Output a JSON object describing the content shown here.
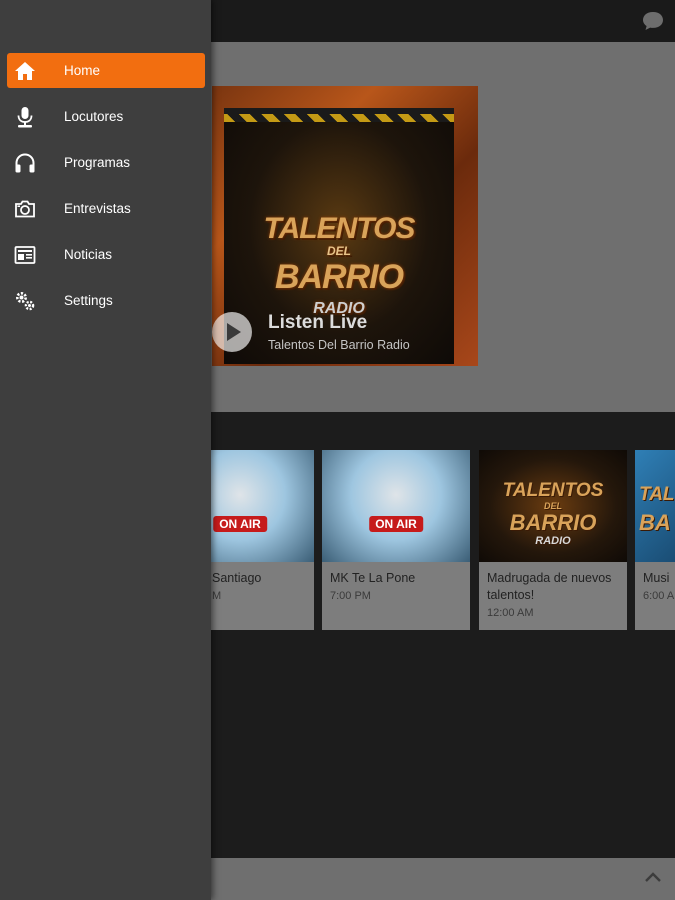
{
  "app": {
    "accent_color": "#f26e10",
    "drawer_color": "#3e3e3e"
  },
  "drawer": {
    "items": [
      {
        "label": "Home",
        "icon": "home-icon",
        "active": true
      },
      {
        "label": "Locutores",
        "icon": "microphone-icon",
        "active": false
      },
      {
        "label": "Programas",
        "icon": "headphones-icon",
        "active": false
      },
      {
        "label": "Entrevistas",
        "icon": "camera-icon",
        "active": false
      },
      {
        "label": "Noticias",
        "icon": "newspaper-icon",
        "active": false
      },
      {
        "label": "Settings",
        "icon": "gears-icon",
        "active": false
      }
    ]
  },
  "hero": {
    "logo_line_1": "TALENTOS",
    "logo_line_2": "DEL",
    "logo_line_3": "BARRIO",
    "logo_line_4": "RADIO",
    "title": "Listen Live",
    "subtitle": "Talentos Del Barrio Radio"
  },
  "programs": [
    {
      "title": "Santiago",
      "time": "M",
      "badge": "ON AIR",
      "art": "onair"
    },
    {
      "title": "MK Te La Pone",
      "time": "7:00 PM",
      "badge": "ON AIR",
      "art": "onair"
    },
    {
      "title": "Madrugada de nuevos talentos!",
      "time": "12:00 AM",
      "art": "logo",
      "logo_1": "TALENTOS",
      "logo_2": "DEL",
      "logo_3": "BARRIO",
      "logo_4": "RADIO"
    },
    {
      "title": "Musi",
      "time": "6:00 A",
      "art": "logo",
      "logo_1": "TALENTOS",
      "logo_3": "BA"
    }
  ],
  "icons": {
    "chat": "chat-bubble-icon",
    "collapse": "chevron-up-icon"
  }
}
